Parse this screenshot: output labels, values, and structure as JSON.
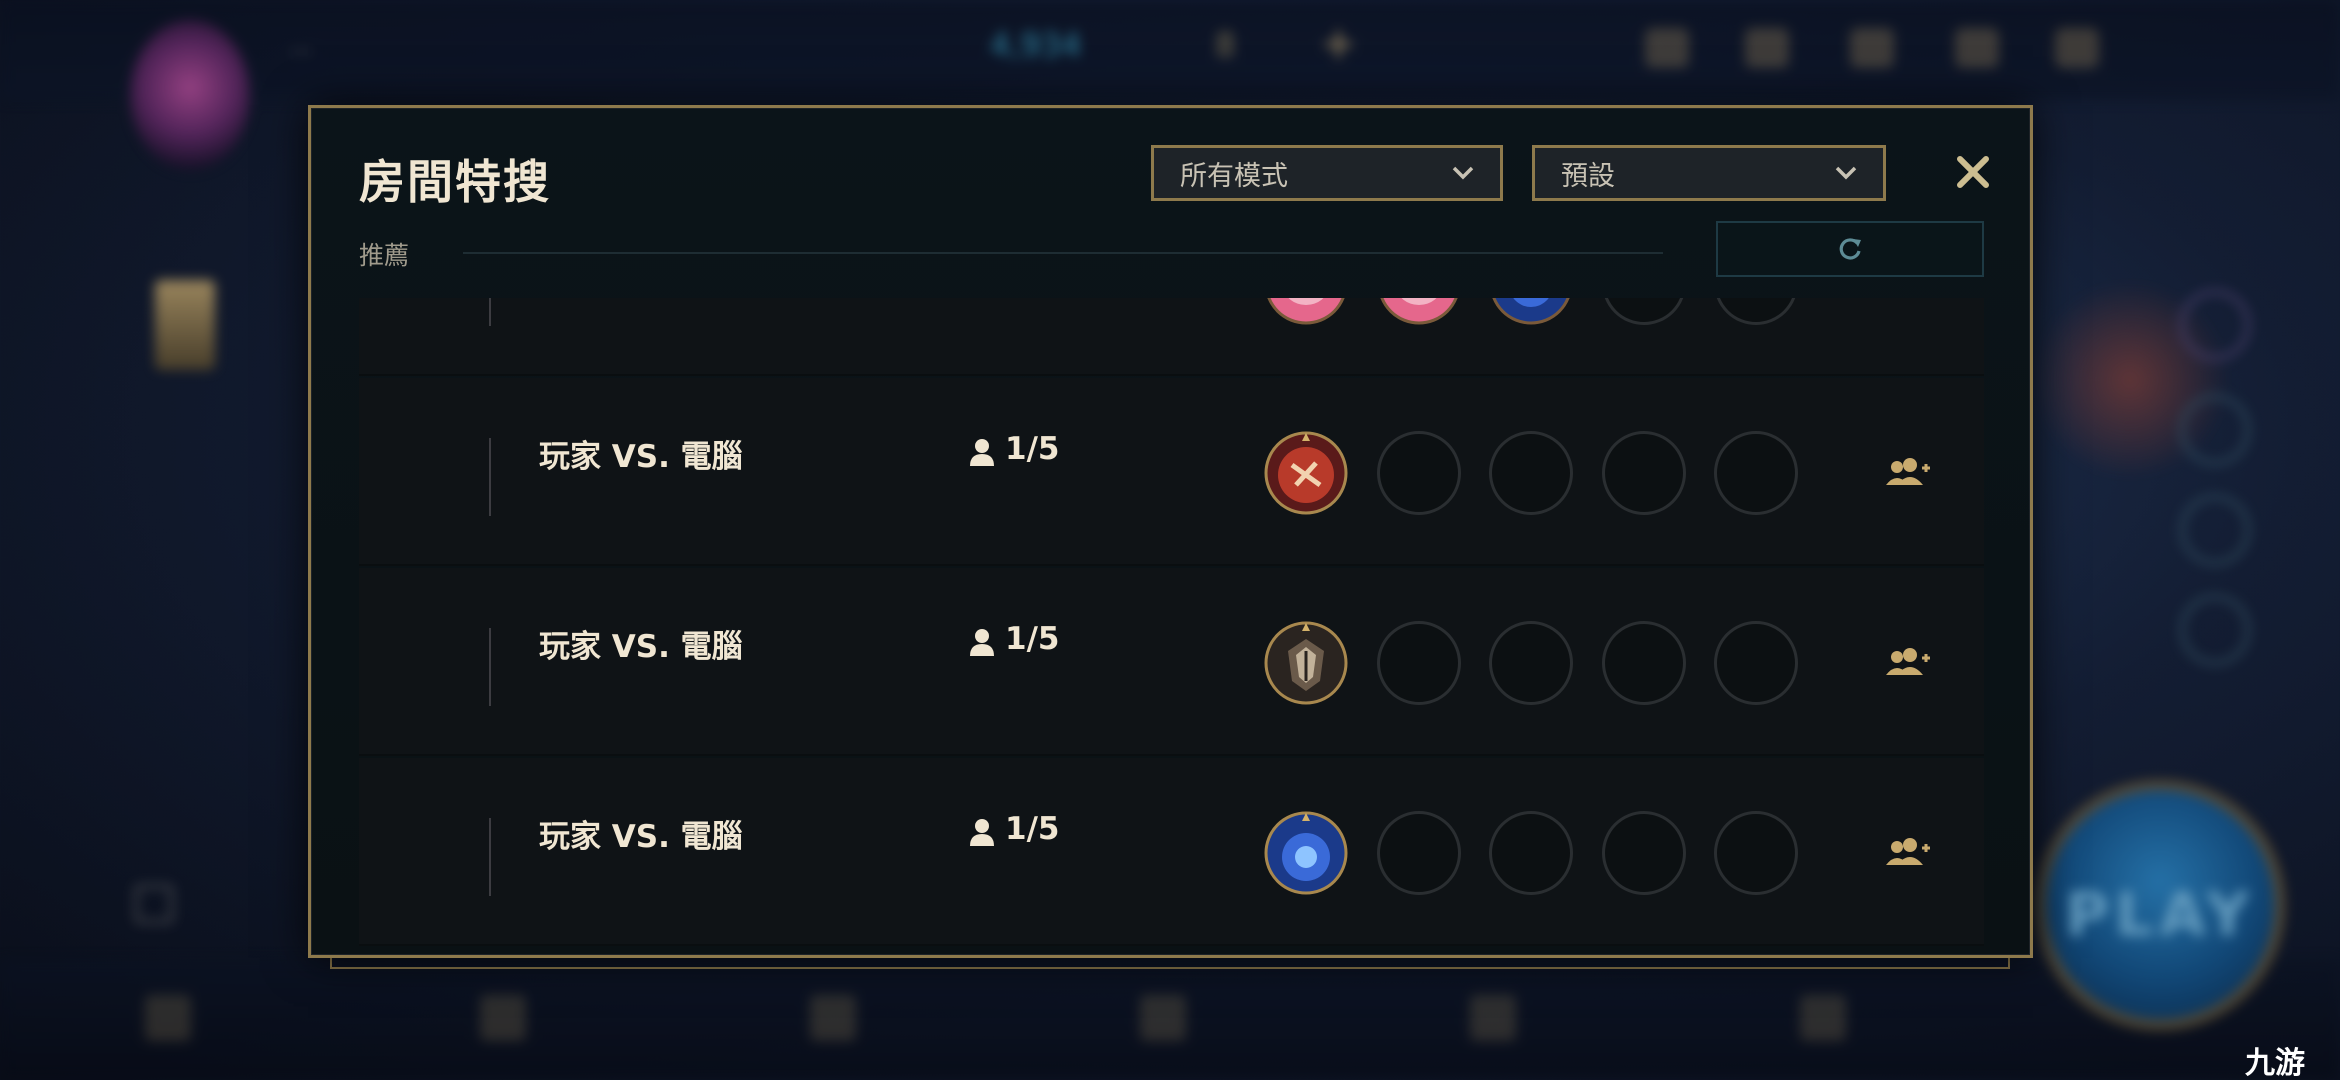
{
  "background": {
    "player_level": "···",
    "blue_essence": "4,934",
    "riot_points": "8",
    "chest_label": "",
    "play_button": "PLAY"
  },
  "modal": {
    "title": "房間特搜",
    "mode_filter": "所有模式",
    "sort_filter": "預設",
    "recommended_label": "推薦"
  },
  "rooms": [
    {
      "mode": "",
      "count": "",
      "icons": [
        "poro-pink",
        "poro-pink",
        "blue-emblem"
      ],
      "partial": true
    },
    {
      "mode": "玩家 VS. 電腦",
      "count": "1/5",
      "icons": [
        "red-emblem"
      ]
    },
    {
      "mode": "玩家 VS. 電腦",
      "count": "1/5",
      "icons": [
        "armor-emblem"
      ]
    },
    {
      "mode": "玩家 VS. 電腦",
      "count": "1/5",
      "icons": [
        "blue-emblem"
      ]
    }
  ],
  "watermark": "九游",
  "colors": {
    "gold": "#c8aa6e",
    "border_gold": "#8e7a4c",
    "text": "#f0e6d2"
  }
}
